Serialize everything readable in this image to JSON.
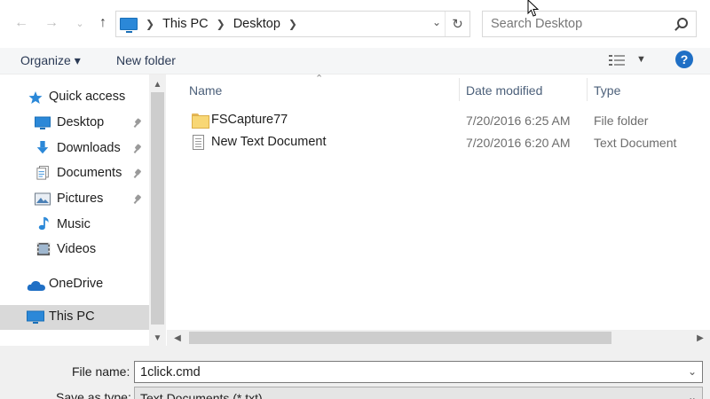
{
  "address": {
    "crumbs": [
      "This PC",
      "Desktop"
    ]
  },
  "search": {
    "placeholder": "Search Desktop"
  },
  "toolbar": {
    "organize": "Organize ▾",
    "new_folder": "New folder",
    "help": "?"
  },
  "nav": {
    "items": [
      {
        "label": "Quick access",
        "icon": "star-icon"
      },
      {
        "label": "Desktop",
        "icon": "desktop-icon",
        "pinned": true
      },
      {
        "label": "Downloads",
        "icon": "download-icon",
        "pinned": true
      },
      {
        "label": "Documents",
        "icon": "documents-icon",
        "pinned": true
      },
      {
        "label": "Pictures",
        "icon": "pictures-icon",
        "pinned": true
      },
      {
        "label": "Music",
        "icon": "music-icon"
      },
      {
        "label": "Videos",
        "icon": "videos-icon"
      },
      {
        "label": "OneDrive",
        "icon": "cloud-icon"
      },
      {
        "label": "This PC",
        "icon": "computer-icon",
        "selected": true
      }
    ]
  },
  "columns": {
    "name": "Name",
    "date": "Date modified",
    "type": "Type"
  },
  "files": [
    {
      "name": "FSCapture77",
      "date": "7/20/2016 6:25 AM",
      "type": "File folder",
      "icon": "folder-icon"
    },
    {
      "name": "New Text Document",
      "date": "7/20/2016 6:20 AM",
      "type": "Text Document",
      "icon": "text-document-icon"
    }
  ],
  "form": {
    "file_name_label": "File name:",
    "file_name_value": "1click.cmd",
    "save_type_label": "Save as type:",
    "save_type_value": "Text Documents (*.txt)"
  },
  "colors": {
    "accent": "#2b88d8",
    "selected_bg": "#d9d9d9",
    "folder": "#f8d775",
    "help_bg": "#1f6fc5"
  }
}
